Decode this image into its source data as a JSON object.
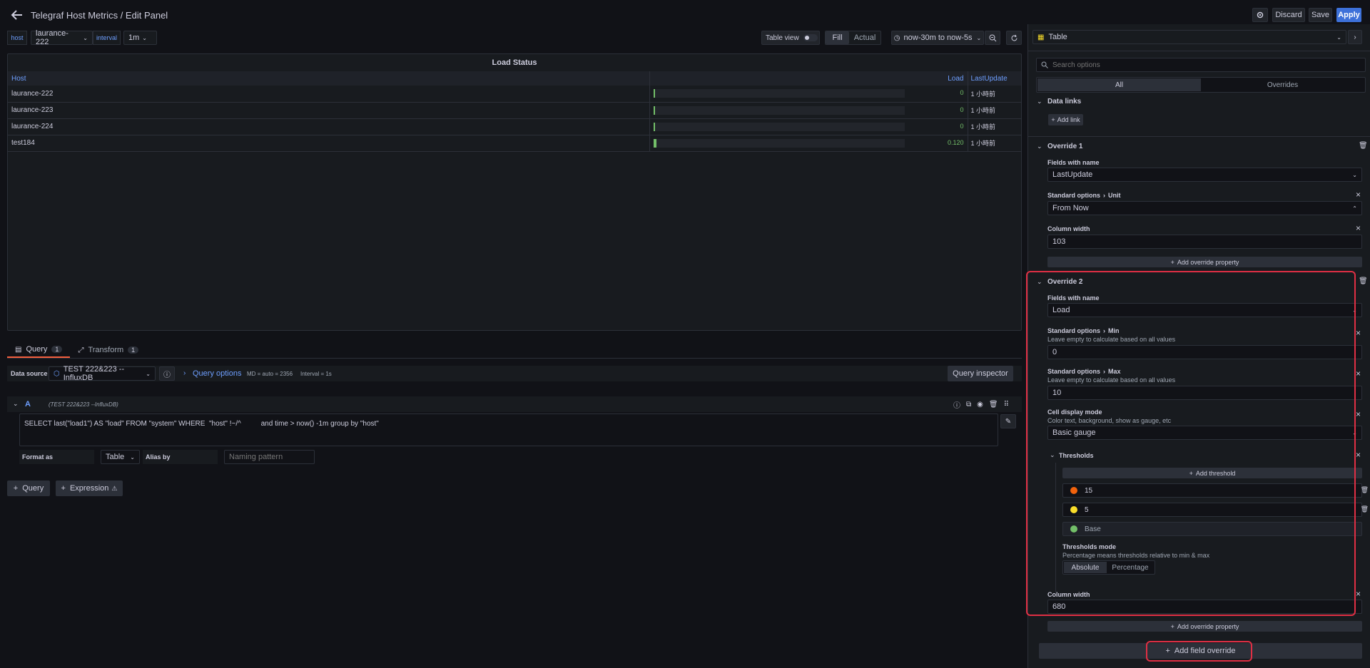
{
  "header": {
    "title": "Telegraf Host Metrics / Edit Panel",
    "discard": "Discard",
    "save": "Save",
    "apply": "Apply"
  },
  "variables": {
    "host_label": "host",
    "host_value": "laurance-222",
    "interval_label": "interval",
    "interval_value": "1m"
  },
  "toolbar": {
    "table_view": "Table view",
    "fill": "Fill",
    "actual": "Actual",
    "time_range": "now-30m to now-5s"
  },
  "visualization": {
    "name": "Table"
  },
  "panel": {
    "title": "Load Status",
    "columns": [
      "Host",
      "Load",
      "LastUpdate"
    ],
    "rows": [
      {
        "host": "laurance-222",
        "load": "0",
        "load_fraction": 0.0,
        "updated": "1 小時前"
      },
      {
        "host": "laurance-223",
        "load": "0",
        "load_fraction": 0.0,
        "updated": "1 小時前"
      },
      {
        "host": "laurance-224",
        "load": "0",
        "load_fraction": 0.0,
        "updated": "1 小時前"
      },
      {
        "host": "test184",
        "load": "0.120",
        "load_fraction": 0.012,
        "updated": "1 小時前"
      }
    ]
  },
  "query_tabs": {
    "query": "Query",
    "query_count": "1",
    "transform": "Transform",
    "transform_count": "1"
  },
  "datasource": {
    "label": "Data source",
    "value": "TEST 222&223 --InfluxDB",
    "query_options": "Query options",
    "md": "MD = auto = 2356",
    "interval": "Interval = 1s",
    "inspector": "Query inspector"
  },
  "query": {
    "ref": "A",
    "source": "(TEST 222&223 --InfluxDB)",
    "sql": "SELECT last(\"load1\") AS \"load\" FROM \"system\" WHERE  \"host\" !~/^          and time > now() -1m group by \"host\"",
    "format_label": "Format as",
    "format_value": "Table",
    "alias_label": "Alias by",
    "alias_placeholder": "Naming pattern"
  },
  "add_buttons": {
    "query": "Query",
    "expression": "Expression"
  },
  "options": {
    "search_placeholder": "Search options",
    "tab_all": "All",
    "tab_overrides": "Overrides",
    "data_links": "Data links",
    "add_link": "Add link",
    "override1": {
      "title": "Override 1",
      "fields_label": "Fields with name",
      "fields_value": "LastUpdate",
      "unit_path1": "Standard options",
      "unit_path2": "Unit",
      "unit_value": "From Now",
      "width_label": "Column width",
      "width_value": "103",
      "add_property": "Add override property"
    },
    "override2": {
      "title": "Override 2",
      "fields_label": "Fields with name",
      "fields_value": "Load",
      "min_path1": "Standard options",
      "min_path2": "Min",
      "min_desc": "Leave empty to calculate based on all values",
      "min_value": "0",
      "max_path1": "Standard options",
      "max_path2": "Max",
      "max_desc": "Leave empty to calculate based on all values",
      "max_value": "10",
      "cell_label": "Cell display mode",
      "cell_desc": "Color text, background, show as gauge, etc",
      "cell_value": "Basic gauge",
      "thresholds_label": "Thresholds",
      "add_threshold": "Add threshold",
      "thresholds": [
        {
          "value": "15",
          "color": "#f2620c"
        },
        {
          "value": "5",
          "color": "#fade2a"
        },
        {
          "value": "Base",
          "color": "#73bf69"
        }
      ],
      "mode_label": "Thresholds mode",
      "mode_desc": "Percentage means thresholds relative to min & max",
      "mode_absolute": "Absolute",
      "mode_percentage": "Percentage",
      "width_label": "Column width",
      "width_value": "680",
      "add_property": "Add override property"
    },
    "add_field_override": "Add field override"
  }
}
